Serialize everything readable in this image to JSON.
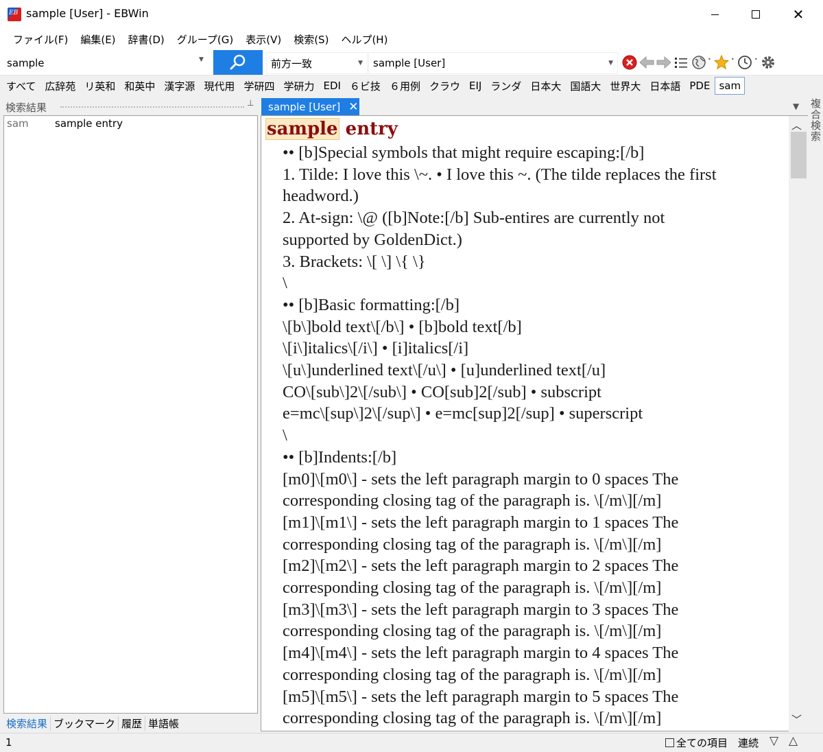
{
  "window": {
    "title": "sample [User] - EBWin",
    "app_icon_text": "EB"
  },
  "menu": [
    {
      "label": "ファイル(F)"
    },
    {
      "label": "編集(E)"
    },
    {
      "label": "辞書(D)"
    },
    {
      "label": "グループ(G)"
    },
    {
      "label": "表示(V)"
    },
    {
      "label": "検索(S)"
    },
    {
      "label": "ヘルプ(H)"
    }
  ],
  "toolbar": {
    "search_value": "sample",
    "mode_label": "前方一致",
    "dict_label": "sample [User]",
    "icons": [
      "stop-icon",
      "back-icon",
      "forward-icon",
      "list-icon",
      "globe-icon",
      "favorite-star-icon",
      "history-clock-icon",
      "settings-gear-icon"
    ]
  },
  "dictionaries": [
    {
      "label": "すべて"
    },
    {
      "label": "広辞苑"
    },
    {
      "label": "リ英和"
    },
    {
      "label": "和英中"
    },
    {
      "label": "漢字源"
    },
    {
      "label": "現代用"
    },
    {
      "label": "学研四"
    },
    {
      "label": "学研力"
    },
    {
      "label": "EDI"
    },
    {
      "label": "６ビ技"
    },
    {
      "label": "６用例"
    },
    {
      "label": "クラウ"
    },
    {
      "label": "EIJ"
    },
    {
      "label": "ランダ"
    },
    {
      "label": "日本大"
    },
    {
      "label": "国語大"
    },
    {
      "label": "世界大"
    },
    {
      "label": "日本語"
    },
    {
      "label": "PDE"
    },
    {
      "label": "sam",
      "selected": true
    }
  ],
  "left_pane": {
    "header": "検索結果",
    "results": [
      {
        "key": "sam",
        "title": "sample entry"
      }
    ],
    "tabs": [
      {
        "label": "検索結果",
        "selected": true
      },
      {
        "label": "ブックマーク"
      },
      {
        "label": "履歴"
      },
      {
        "label": "単語帳"
      }
    ]
  },
  "content": {
    "tab_label": "sample [User]",
    "heading_highlight": "sample",
    "heading_rest": " entry",
    "lines": [
      "•• [b]Special symbols that might require escaping:[/b]",
      "1. Tilde: I love this \\~. • I love this ~. (The tilde replaces the first",
      "headword.)",
      "2. At-sign: \\@ ([b]Note:[/b] Sub-entires are currently not",
      "supported by GoldenDict.)",
      "3. Brackets: \\[ \\] \\{ \\}",
      "\\",
      "•• [b]Basic formatting:[/b]",
      "\\[b\\]bold text\\[/b\\] • [b]bold text[/b]",
      "\\[i\\]italics\\[/i\\] • [i]italics[/i]",
      "\\[u\\]underlined text\\[/u\\] • [u]underlined text[/u]",
      "CO\\[sub\\]2\\[/sub\\] • CO[sub]2[/sub] • subscript",
      "e=mc\\[sup\\]2\\[/sup\\] • e=mc[sup]2[/sup] • superscript",
      "\\",
      "•• [b]Indents:[/b]",
      "[m0]\\[m0\\] - sets the left paragraph margin to 0 spaces The",
      "corresponding closing tag of the paragraph is. \\[/m\\][/m]",
      "[m1]\\[m1\\] - sets the left paragraph margin to 1 spaces The",
      "corresponding closing tag of the paragraph is. \\[/m\\][/m]",
      "[m2]\\[m2\\] - sets the left paragraph margin to 2 spaces The",
      "corresponding closing tag of the paragraph is. \\[/m\\][/m]",
      "[m3]\\[m3\\] - sets the left paragraph margin to 3 spaces The",
      "corresponding closing tag of the paragraph is. \\[/m\\][/m]",
      "[m4]\\[m4\\] - sets the left paragraph margin to 4 spaces The",
      "corresponding closing tag of the paragraph is. \\[/m\\][/m]",
      "[m5]\\[m5\\] - sets the left paragraph margin to 5 spaces The",
      "corresponding closing tag of the paragraph is. \\[/m\\][/m]"
    ]
  },
  "side_tab": "複合検索",
  "status": {
    "count": "1",
    "all_items": "全ての項目",
    "continuous": "連続"
  }
}
